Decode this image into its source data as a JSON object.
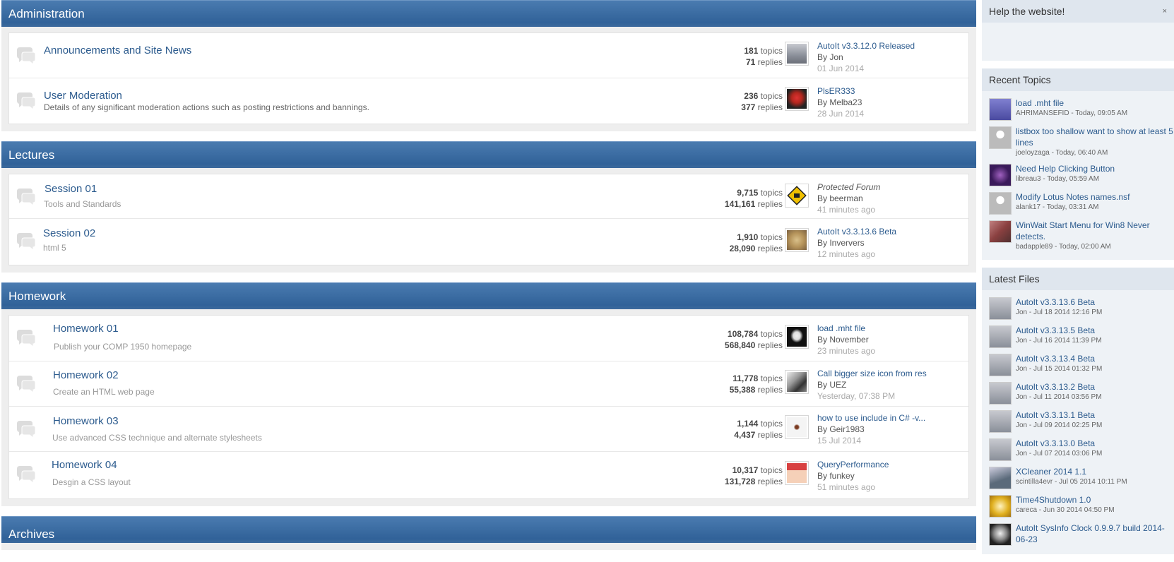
{
  "categories": [
    {
      "title": "Administration",
      "forums": [
        {
          "title": "Announcements and Site News",
          "desc": "",
          "topics": "181",
          "replies": "71",
          "last_title": "AutoIt v3.3.12.0 Released",
          "last_by": "By Jon",
          "last_date": "01 Jun 2014",
          "avatar_color": "#8a8f99"
        },
        {
          "title": "User Moderation",
          "desc": "Details of any significant moderation actions such as posting restrictions and bannings.",
          "topics": "236",
          "replies": "377",
          "last_title": "PlsER333",
          "last_by": "By Melba23",
          "last_date": "28 Jun 2014",
          "avatar_color": "#b3261e"
        }
      ]
    },
    {
      "title": "Lectures",
      "forums": [
        {
          "title": "Session 01",
          "desc": "Tools and Standards",
          "topics": "9,715",
          "replies": "141,161",
          "last_title": "Protected Forum",
          "last_by": "By beerman",
          "last_date": "41 minutes ago",
          "avatar_color": "#f0c000"
        },
        {
          "title": "Session 02",
          "desc": "html 5",
          "topics": "1,910",
          "replies": "28,090",
          "last_title": "AutoIt v3.3.13.6 Beta",
          "last_by": "By Inververs",
          "last_date": "12 minutes ago",
          "avatar_color": "#b5935a"
        }
      ]
    },
    {
      "title": "Homework",
      "forums": [
        {
          "title": "Homework 01",
          "desc": "Publish your COMP 1950 homepage",
          "topics": "108,784",
          "replies": "568,840",
          "last_title": "load .mht file",
          "last_by": "By November",
          "last_date": "23 minutes ago",
          "avatar_color": "#111111"
        },
        {
          "title": "Homework 02",
          "desc": "Create an HTML web page",
          "topics": "11,778",
          "replies": "55,388",
          "last_title": "Call bigger size icon from res",
          "last_by": "By UEZ",
          "last_date": "Yesterday, 07:38 PM",
          "avatar_color": "#555555"
        },
        {
          "title": "Homework 03",
          "desc": "Use advanced CSS technique and alternate stylesheets",
          "topics": "1,144",
          "replies": "4,437",
          "last_title": "how to use include in C# -v...",
          "last_by": "By Geir1983",
          "last_date": "15 Jul 2014",
          "avatar_color": "#f4f4f4"
        },
        {
          "title": "Homework 04",
          "desc": "Desgin a CSS layout",
          "topics": "10,317",
          "replies": "131,728",
          "last_title": "QueryPerformance",
          "last_by": "By funkey",
          "last_date": "51 minutes ago",
          "avatar_color": "#d84040"
        }
      ]
    },
    {
      "title": "Archives",
      "forums": []
    }
  ],
  "labels": {
    "topics": "topics",
    "replies": "replies"
  },
  "sidebar": {
    "help": {
      "title": "Help the website!",
      "close": "×"
    },
    "recent": {
      "title": "Recent Topics",
      "items": [
        {
          "title": "load .mht file",
          "meta": "AHRIMANSEFID - Today, 09:05 AM",
          "avatar_color": "#4a4aa0"
        },
        {
          "title": "listbox too shallow want to show at least 5 lines",
          "meta": "joeloyzaga - Today, 06:40 AM",
          "avatar_color": "#bbbbbb"
        },
        {
          "title": "Need Help Clicking Button",
          "meta": "libreau3 - Today, 05:59 AM",
          "avatar_color": "#3a1a5a"
        },
        {
          "title": "Modify Lotus Notes names.nsf",
          "meta": "alank17 - Today, 03:31 AM",
          "avatar_color": "#bbbbbb"
        },
        {
          "title": "WinWait Start Menu for Win8 Never detects.",
          "meta": "badapple89 - Today, 02:00 AM",
          "avatar_color": "#8a4040"
        }
      ]
    },
    "files": {
      "title": "Latest Files",
      "items": [
        {
          "title": "AutoIt v3.3.13.6 Beta",
          "meta": "Jon - Jul 18 2014 12:16 PM",
          "avatar_color": "#8a8f99"
        },
        {
          "title": "AutoIt v3.3.13.5 Beta",
          "meta": "Jon - Jul 16 2014 11:39 PM",
          "avatar_color": "#8a8f99"
        },
        {
          "title": "AutoIt v3.3.13.4 Beta",
          "meta": "Jon - Jul 15 2014 01:32 PM",
          "avatar_color": "#8a8f99"
        },
        {
          "title": "AutoIt v3.3.13.2 Beta",
          "meta": "Jon - Jul 11 2014 03:56 PM",
          "avatar_color": "#8a8f99"
        },
        {
          "title": "AutoIt v3.3.13.1 Beta",
          "meta": "Jon - Jul 09 2014 02:25 PM",
          "avatar_color": "#8a8f99"
        },
        {
          "title": "AutoIt v3.3.13.0 Beta",
          "meta": "Jon - Jul 07 2014 03:06 PM",
          "avatar_color": "#8a8f99"
        },
        {
          "title": "XCleaner 2014 1.1",
          "meta": "scintilla4evr - Jul 05 2014 10:11 PM",
          "avatar_color": "#5a6a7a"
        },
        {
          "title": "Time4Shutdown 1.0",
          "meta": "careca - Jun 30 2014 04:50 PM",
          "avatar_color": "#e0b020"
        },
        {
          "title": "AutoIt SysInfo Clock 0.9.9.7 build 2014-06-23",
          "meta": "",
          "avatar_color": "#222222"
        }
      ]
    }
  }
}
